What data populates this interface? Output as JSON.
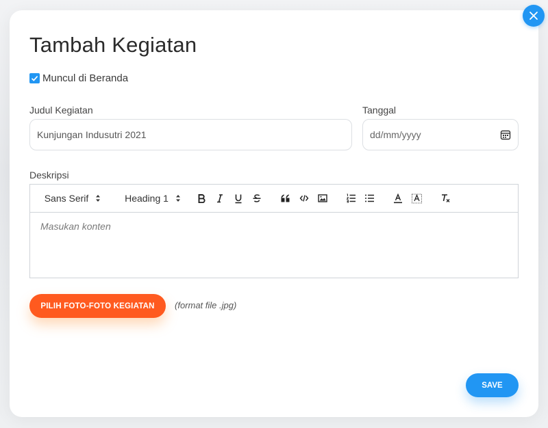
{
  "modal": {
    "title": "Tambah Kegiatan",
    "show_on_home": {
      "label": "Muncul di Beranda",
      "checked": true
    },
    "fields": {
      "title_label": "Judul Kegiatan",
      "title_value": "Kunjungan Indusutri 2021",
      "date_label": "Tanggal",
      "date_placeholder": "dd/mm/yyyy",
      "description_label": "Deskripsi"
    },
    "editor": {
      "font": "Sans Serif",
      "heading": "Heading 1",
      "placeholder": "Masukan konten",
      "tools": [
        "bold",
        "italic",
        "underline",
        "strike",
        "blockquote",
        "code",
        "image",
        "ordered-list",
        "bullet-list",
        "text-color",
        "background-color",
        "clear-format"
      ]
    },
    "upload_button": "PILIH FOTO-FOTO KEGIATAN",
    "format_note": "(format file .jpg)",
    "save_button": "SAVE"
  },
  "colors": {
    "primary": "#2196f3",
    "accent": "#ff5a1f"
  }
}
